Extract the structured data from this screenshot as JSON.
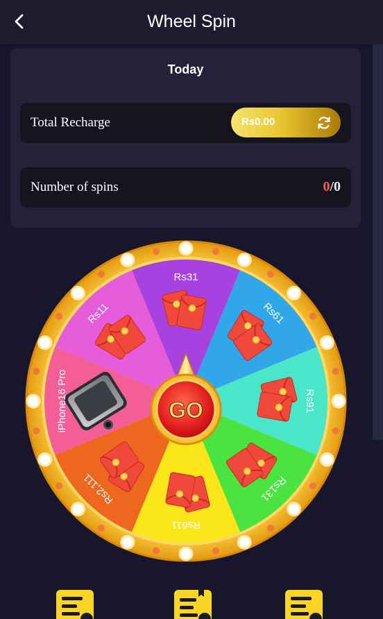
{
  "header": {
    "title": "Wheel Spin",
    "back_icon": "chevron-left-icon"
  },
  "today": {
    "title": "Today",
    "total_recharge_label": "Total Recharge",
    "total_recharge_value": "Rs0.00",
    "refresh_icon": "refresh-icon",
    "spins_label": "Number of spins",
    "spins_used": "0",
    "spins_separator": "/",
    "spins_total": "0"
  },
  "wheel": {
    "go_label": "GO",
    "segments": [
      {
        "label": "Rs11",
        "color": "#e65ddc",
        "prize": "red-envelope"
      },
      {
        "label": "Rs31",
        "color": "#a742e1",
        "prize": "red-envelope"
      },
      {
        "label": "Rs61",
        "color": "#31a6e9",
        "prize": "red-envelope"
      },
      {
        "label": "Rs91",
        "color": "#49e6c9",
        "prize": "red-envelope"
      },
      {
        "label": "Rs131",
        "color": "#4be33f",
        "prize": "red-envelope"
      },
      {
        "label": "Rs611",
        "color": "#fae619",
        "prize": "red-envelope"
      },
      {
        "label": "Rs2,111",
        "color": "#ee671f",
        "prize": "red-envelope"
      },
      {
        "label": "iPhone16 Pro",
        "color": "#f45e97",
        "prize": "phone"
      }
    ]
  },
  "bottom_nav": {
    "icons": [
      "rules-document-icon",
      "history-document-icon",
      "records-document-icon"
    ]
  },
  "colors": {
    "background": "#17162a",
    "card": "#232238",
    "row": "#15141f",
    "accent_gold": "#e9c630",
    "rim_gold": "#f3b621",
    "spins_used": "#ff5a5a"
  }
}
